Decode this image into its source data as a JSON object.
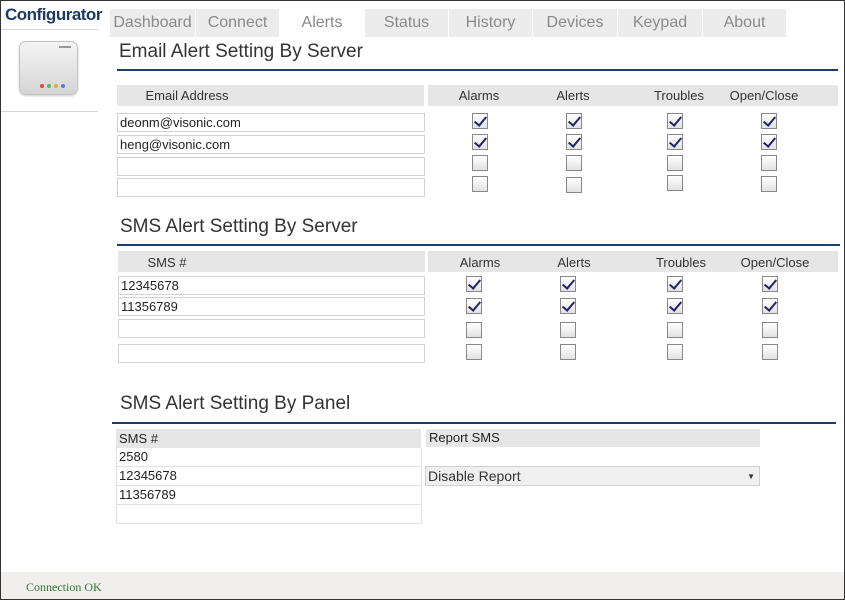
{
  "app": {
    "title": "Configurator"
  },
  "tabs": [
    {
      "label": "Dashboard",
      "active": false
    },
    {
      "label": "Connect",
      "active": false
    },
    {
      "label": "Alerts",
      "active": true
    },
    {
      "label": "Status",
      "active": false
    },
    {
      "label": "History",
      "active": false
    },
    {
      "label": "Devices",
      "active": false
    },
    {
      "label": "Keypad",
      "active": false
    },
    {
      "label": "About",
      "active": false
    }
  ],
  "email_section": {
    "title": "Email Alert Setting By Server",
    "columns": {
      "address": "Email Address",
      "alarms": "Alarms",
      "alerts": "Alerts",
      "troubles": "Troubles",
      "openclose": "Open/Close"
    },
    "rows": [
      {
        "value": "deonm@visonic.com",
        "alarms": true,
        "alerts": true,
        "troubles": true,
        "openclose": true
      },
      {
        "value": "heng@visonic.com",
        "alarms": true,
        "alerts": true,
        "troubles": true,
        "openclose": true
      },
      {
        "value": "",
        "alarms": false,
        "alerts": false,
        "troubles": false,
        "openclose": false
      },
      {
        "value": "",
        "alarms": false,
        "alerts": false,
        "troubles": false,
        "openclose": false
      }
    ]
  },
  "sms_server_section": {
    "title": "SMS Alert Setting By Server",
    "columns": {
      "number": "SMS #",
      "alarms": "Alarms",
      "alerts": "Alerts",
      "troubles": "Troubles",
      "openclose": "Open/Close"
    },
    "rows": [
      {
        "value": "12345678",
        "alarms": true,
        "alerts": true,
        "troubles": true,
        "openclose": true
      },
      {
        "value": "11356789",
        "alarms": true,
        "alerts": true,
        "troubles": true,
        "openclose": true
      },
      {
        "value": "",
        "alarms": false,
        "alerts": false,
        "troubles": false,
        "openclose": false
      },
      {
        "value": "",
        "alarms": false,
        "alerts": false,
        "troubles": false,
        "openclose": false
      }
    ]
  },
  "sms_panel_section": {
    "title": "SMS Alert Setting By Panel",
    "columns": {
      "number": "SMS #",
      "report": "Report SMS"
    },
    "numbers": [
      "2580",
      "12345678",
      "11356789",
      ""
    ],
    "report_value": "Disable Report"
  },
  "status": {
    "text": "Connection OK"
  },
  "colors": {
    "accent": "#1d3e6c",
    "status_ok": "#2f7a2f",
    "check": "#22236b"
  }
}
